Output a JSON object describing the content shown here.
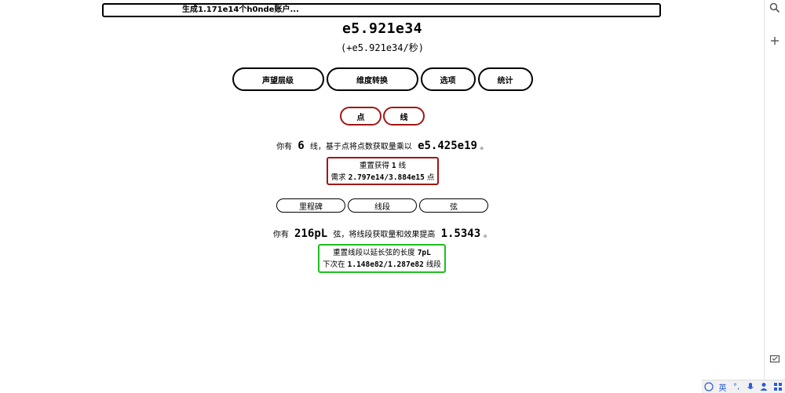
{
  "banner": {
    "text": "生成1.171e14个h0nde账户..."
  },
  "main": {
    "amount": "e5.921e34",
    "rate": "(+e5.921e34/秒)"
  },
  "tabs": [
    {
      "label": "声望层级"
    },
    {
      "label": "维度转换"
    },
    {
      "label": "选项"
    },
    {
      "label": "统计"
    }
  ],
  "subtabs": [
    {
      "label": "点"
    },
    {
      "label": "线"
    }
  ],
  "lines": {
    "prefix": "你有",
    "count": "6",
    "middle": "线，基于点将点数获取量乘以",
    "multiplier": "e5.425e19",
    "suffix": "。"
  },
  "line_reset": {
    "line1_prefix": "重置获得",
    "line1_value": "1",
    "line1_suffix": "线",
    "line2_prefix": "需求",
    "line2_value": "2.797e14/3.884e15",
    "line2_suffix": "点"
  },
  "pills": [
    {
      "label": "里程碑"
    },
    {
      "label": "线段"
    },
    {
      "label": "弦"
    }
  ],
  "strings": {
    "prefix": "你有",
    "count": "216pL",
    "middle": "弦，将线段获取量和效果提高",
    "multiplier": "1.5343",
    "suffix": "。"
  },
  "string_reset": {
    "line1_prefix": "重置线段以延长弦的长度",
    "line1_value": "7pL",
    "line2_prefix": "下次在",
    "line2_value": "1.148e82/1.287e82",
    "line2_suffix": "线段"
  },
  "sidepanel": {
    "icons": [
      "search-icon",
      "plus-icon",
      "screenshot-icon"
    ]
  },
  "ime": {
    "items": [
      "英",
      "°,",
      "🎤",
      "👤",
      "▦"
    ]
  }
}
